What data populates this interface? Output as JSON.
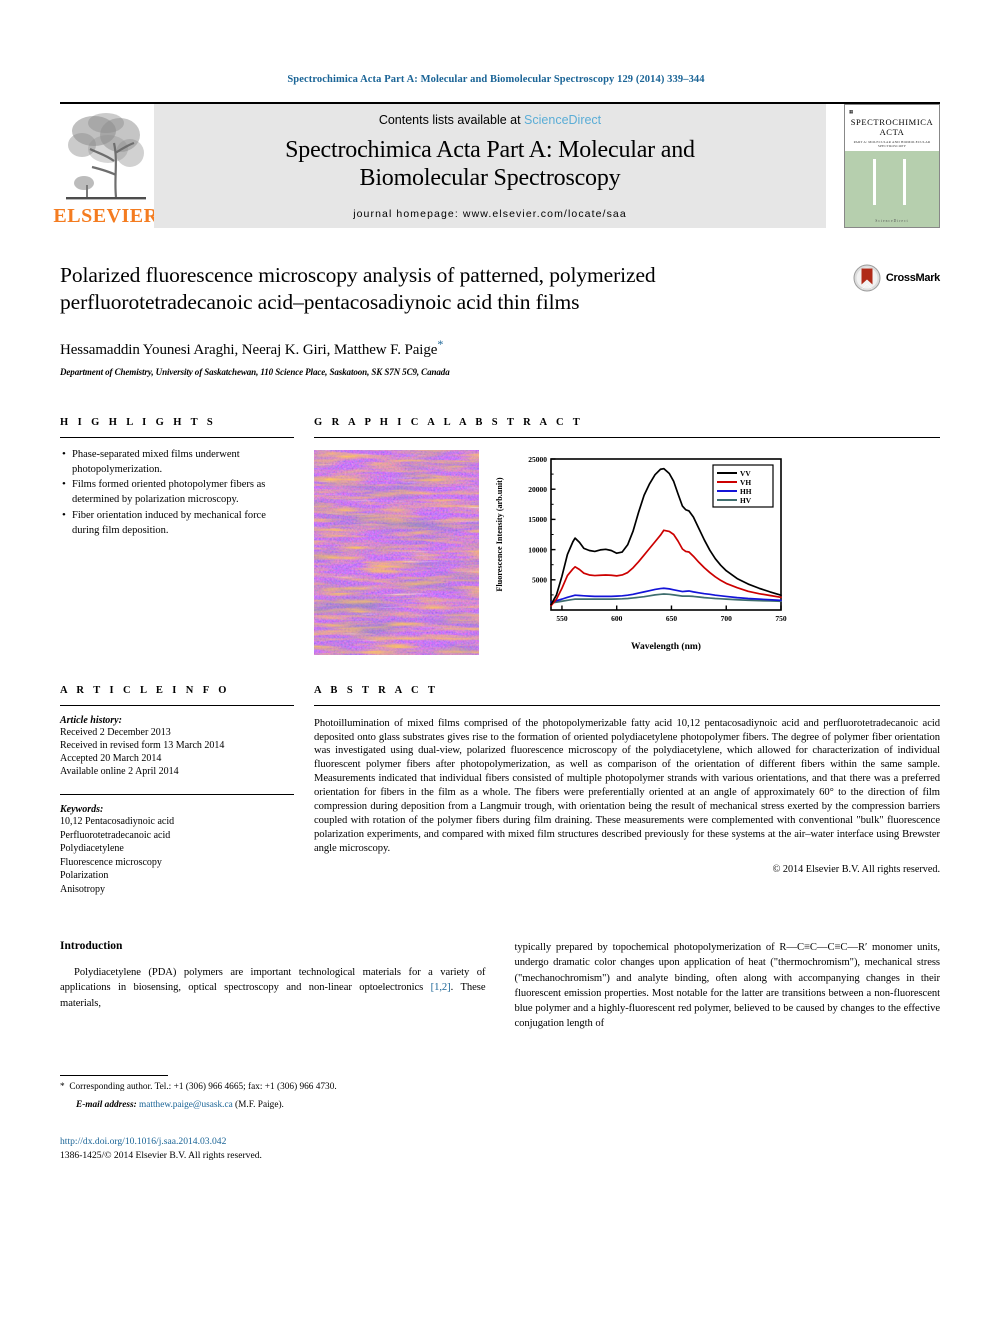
{
  "running_head": "Spectrochimica Acta Part A: Molecular and Biomolecular Spectroscopy 129 (2014) 339–344",
  "masthead": {
    "contents_prefix": "Contents lists available at ",
    "sciencedirect": "ScienceDirect",
    "journal_title_line1": "Spectrochimica Acta Part A: Molecular and",
    "journal_title_line2": "Biomolecular Spectroscopy",
    "homepage": "journal homepage: www.elsevier.com/locate/saa",
    "publisher": "ELSEVIER",
    "cover": {
      "title_line1": "SPECTROCHIMICA",
      "title_line2": "ACTA",
      "subtitle": "PART A: MOLECULAR AND BIOMOLECULAR SPECTROSCOPY",
      "footer": "ScienceDirect"
    }
  },
  "article": {
    "title": "Polarized fluorescence microscopy analysis of patterned, polymerized perfluorotetradecanoic acid–pentacosadiynoic acid thin films",
    "authors": "Hessamaddin Younesi Araghi, Neeraj K. Giri, Matthew F. Paige",
    "author_star": "*",
    "affiliation": "Department of Chemistry, University of Saskatchewan, 110 Science Place, Saskatoon, SK S7N 5C9, Canada",
    "crossmark_label": "CrossMark"
  },
  "highlights": {
    "heading": "H I G H L I G H T S",
    "items": [
      "Phase-separated mixed films underwent photopolymerization.",
      "Films formed oriented photopolymer fibers as determined by polarization microscopy.",
      "Fiber orientation induced by mechanical force during film deposition."
    ]
  },
  "graphical_abstract": {
    "heading": "G R A P H I C A L   A B S T R A C T"
  },
  "article_info": {
    "heading": "A R T I C L E    I N F O",
    "history_label": "Article history:",
    "history": [
      "Received 2 December 2013",
      "Received in revised form 13 March 2014",
      "Accepted 20 March 2014",
      "Available online 2 April 2014"
    ],
    "keywords_label": "Keywords:",
    "keywords": [
      "10,12 Pentacosadiynoic acid",
      "Perfluorotetradecanoic acid",
      "Polydiacetylene",
      "Fluorescence microscopy",
      "Polarization",
      "Anisotropy"
    ]
  },
  "abstract": {
    "heading": "A B S T R A C T",
    "text": "Photoillumination of mixed films comprised of the photopolymerizable fatty acid 10,12 pentacosadiynoic acid and perfluorotetradecanoic acid deposited onto glass substrates gives rise to the formation of oriented polydiacetylene photopolymer fibers. The degree of polymer fiber orientation was investigated using dual-view, polarized fluorescence microscopy of the polydiacetylene, which allowed for characterization of individual fluorescent polymer fibers after photopolymerization, as well as comparison of the orientation of different fibers within the same sample. Measurements indicated that individual fibers consisted of multiple photopolymer strands with various orientations, and that there was a preferred orientation for fibers in the film as a whole. The fibers were preferentially oriented at an angle of approximately 60° to the direction of film compression during deposition from a Langmuir trough, with orientation being the result of mechanical stress exerted by the compression barriers coupled with rotation of the polymer fibers during film draining. These measurements were complemented with conventional \"bulk\" fluorescence polarization experiments, and compared with mixed film structures described previously for these systems at the air–water interface using Brewster angle microscopy.",
    "copyright": "© 2014 Elsevier B.V. All rights reserved."
  },
  "body": {
    "intro_heading": "Introduction",
    "left_paragraph_a": "Polydiacetylene (PDA) polymers are important technological materials for a variety of applications in biosensing, optical spectroscopy and non-linear optoelectronics ",
    "left_citation": "[1,2]",
    "left_paragraph_b": ". These materials,",
    "right_paragraph": "typically prepared by topochemical photopolymerization of R—C≡C—C≡C—R′ monomer units, undergo dramatic color changes upon application of heat (\"thermochromism\"), mechanical stress (\"mechanochromism\") and analyte binding, often along with accompanying changes in their fluorescent emission properties. Most notable for the latter are transitions between a non-fluorescent blue polymer and a highly-fluorescent red polymer, believed to be caused by changes to the effective conjugation length of"
  },
  "footer": {
    "corresponding_marker": "*",
    "corresponding": "Corresponding author. Tel.: +1 (306) 966 4665; fax: +1 (306) 966 4730.",
    "email_label": "E-mail address:",
    "email": "matthew.paige@usask.ca",
    "email_owner": "(M.F. Paige).",
    "doi": "http://dx.doi.org/10.1016/j.saa.2014.03.042",
    "issn_line": "1386-1425/© 2014 Elsevier B.V. All rights reserved."
  },
  "chart_data": {
    "type": "line",
    "title": "",
    "xlabel": "Wavelength (nm)",
    "ylabel": "Fluorescence Intensity (arb.unit)",
    "xlim": [
      540,
      750
    ],
    "ylim": [
      0,
      25000
    ],
    "xticks": [
      550,
      600,
      650,
      700,
      750
    ],
    "yticks": [
      5000,
      10000,
      15000,
      20000,
      25000
    ],
    "grid": false,
    "legend_position": "top-right",
    "legend": [
      "VV",
      "VH",
      "HH",
      "HV"
    ],
    "colors": {
      "VV": "#000000",
      "VH": "#cc0000",
      "HH": "#1414d8",
      "HV": "#3f6e6e"
    },
    "x": [
      540,
      545,
      550,
      555,
      560,
      562,
      566,
      570,
      575,
      580,
      585,
      590,
      595,
      600,
      605,
      610,
      615,
      620,
      625,
      630,
      635,
      640,
      643,
      648,
      652,
      656,
      660,
      663,
      666,
      670,
      675,
      680,
      685,
      690,
      695,
      700,
      710,
      720,
      730,
      740,
      750
    ],
    "series": [
      {
        "name": "VV",
        "color": "#000000",
        "values": [
          900,
          2500,
          5600,
          9200,
          11300,
          11900,
          11200,
          10200,
          9850,
          9700,
          9950,
          10050,
          9850,
          9400,
          9600,
          10800,
          13100,
          16200,
          19000,
          20900,
          22400,
          23300,
          23400,
          22600,
          21300,
          19200,
          17200,
          16600,
          16400,
          15400,
          13500,
          11600,
          9900,
          8500,
          7400,
          6500,
          5200,
          4300,
          3600,
          3000,
          2450
        ]
      },
      {
        "name": "VH",
        "color": "#cc0000",
        "values": [
          700,
          1800,
          3600,
          5700,
          6800,
          7150,
          6700,
          6100,
          5800,
          5700,
          5750,
          5800,
          5750,
          5650,
          5800,
          6200,
          7000,
          8000,
          9100,
          10200,
          11300,
          12400,
          13200,
          13000,
          12500,
          11400,
          10100,
          9700,
          9600,
          8900,
          7900,
          7000,
          6200,
          5500,
          4900,
          4400,
          3700,
          3100,
          2700,
          2400,
          2100
        ]
      },
      {
        "name": "HH",
        "color": "#1414d8",
        "values": [
          1300,
          1550,
          1800,
          2100,
          2350,
          2450,
          2400,
          2350,
          2300,
          2250,
          2250,
          2250,
          2250,
          2300,
          2350,
          2450,
          2600,
          2800,
          3000,
          3200,
          3400,
          3550,
          3600,
          3500,
          3350,
          3200,
          3050,
          3100,
          3150,
          3000,
          2850,
          2700,
          2600,
          2450,
          2350,
          2250,
          2050,
          1900,
          1800,
          1700,
          1600
        ]
      },
      {
        "name": "HV",
        "color": "#3f6e6e",
        "values": [
          1150,
          1300,
          1450,
          1600,
          1750,
          1800,
          1800,
          1800,
          1800,
          1800,
          1800,
          1800,
          1800,
          1820,
          1850,
          1900,
          2000,
          2100,
          2200,
          2350,
          2500,
          2600,
          2650,
          2600,
          2500,
          2400,
          2300,
          2300,
          2300,
          2250,
          2150,
          2050,
          1980,
          1900,
          1850,
          1800,
          1700,
          1620,
          1550,
          1500,
          1450
        ]
      }
    ]
  }
}
